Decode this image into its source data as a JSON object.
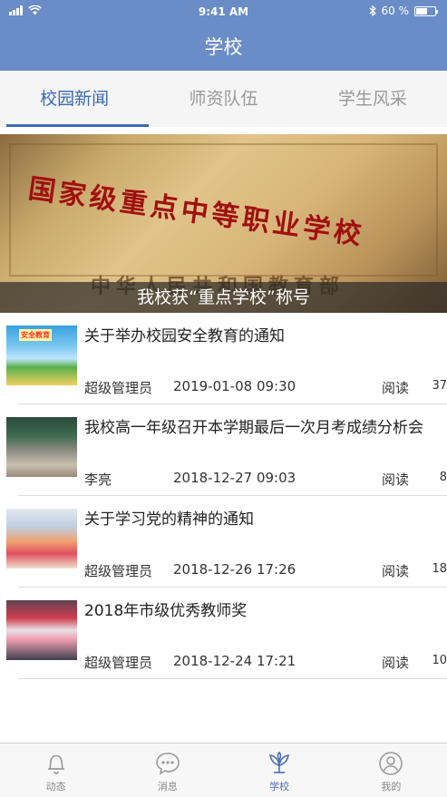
{
  "status_bar": {
    "time": "9:41 AM",
    "battery": "60 %",
    "battery_level": 0.6
  },
  "header": {
    "title": "学校"
  },
  "tabs": [
    {
      "label": "校园新闻",
      "active": true
    },
    {
      "label": "师资队伍",
      "active": false
    },
    {
      "label": "学生风采",
      "active": false
    }
  ],
  "banner": {
    "plaque_text": "国家级重点中等职业学校",
    "plaque_issuer": "中华人民共和国教育部",
    "caption": "我校获“重点学校”称号"
  },
  "news": [
    {
      "title": "关于举办校园安全教育的通知",
      "author": "超级管理员",
      "date": "2019-01-08 09:30",
      "read_label": "阅读",
      "read_count": "37",
      "thumb_text": "安全教育"
    },
    {
      "title": "我校高一年级召开本学期最后一次月考成绩分析会",
      "author": "李亮",
      "date": "2018-12-27 09:03",
      "read_label": "阅读",
      "read_count": "8"
    },
    {
      "title": "关于学习党的精神的通知",
      "author": "超级管理员",
      "date": "2018-12-26 17:26",
      "read_label": "阅读",
      "read_count": "18"
    },
    {
      "title": "2018年市级优秀教师奖",
      "author": "超级管理员",
      "date": "2018-12-24 17:21",
      "read_label": "阅读",
      "read_count": "10"
    }
  ],
  "tabbar": [
    {
      "label": "动态",
      "icon": "bell-icon"
    },
    {
      "label": "消息",
      "icon": "chat-bubble-icon"
    },
    {
      "label": "学校",
      "icon": "school-icon",
      "active": true
    },
    {
      "label": "我的",
      "icon": "user-icon"
    }
  ]
}
